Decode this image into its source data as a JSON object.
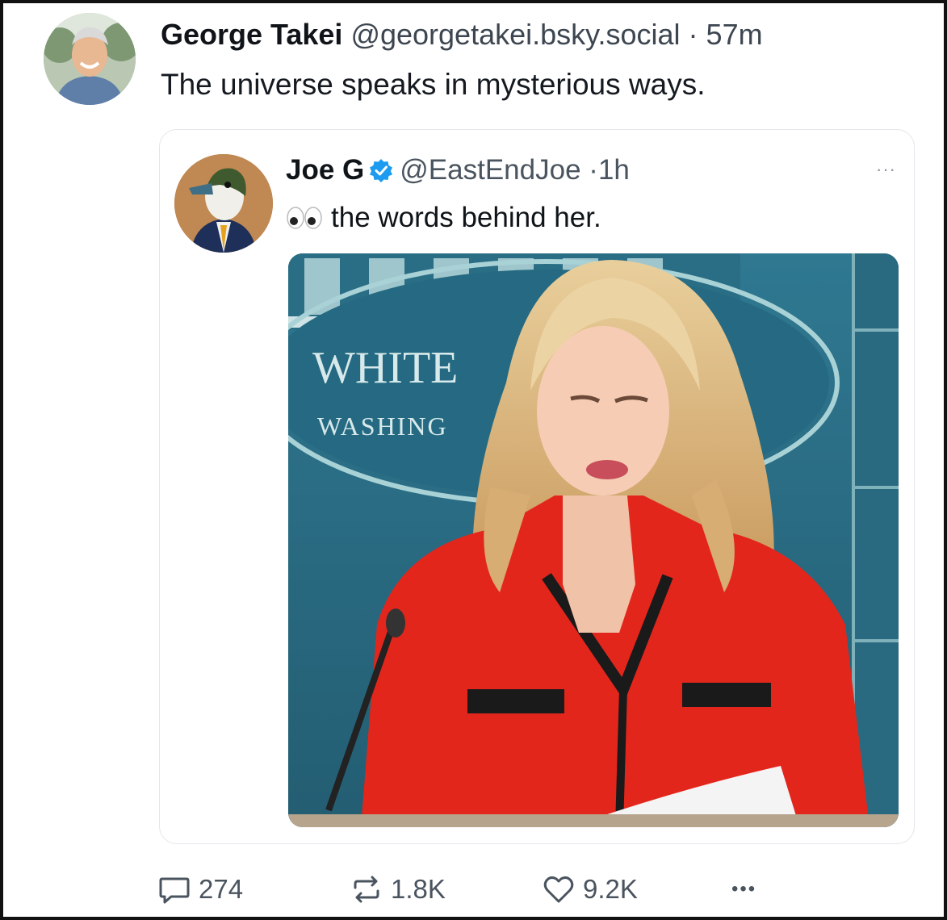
{
  "post": {
    "author_name": "George Takei",
    "author_handle": "@georgetakei.bsky.social",
    "separator": "·",
    "time": "57m",
    "text": "The universe speaks in mysterious ways."
  },
  "quoted_post": {
    "author_name": "Joe G",
    "author_handle": "@EastEndJoe",
    "separator": "·",
    "time": "1h",
    "text": "the words behind her.",
    "more_label": "···",
    "media": {
      "sign_line1": "WHITE",
      "sign_line2": "WASHING"
    }
  },
  "actions": {
    "reply_count": "274",
    "repost_count": "1.8K",
    "like_count": "9.2K",
    "more_label": "•••"
  },
  "colors": {
    "verified": "#1d9bf0",
    "jacket": "#e3261c",
    "backdrop": "#2c6f88"
  },
  "icons": [
    "reply-icon",
    "repost-icon",
    "like-icon",
    "more-icon",
    "verified-icon",
    "eyes-emoji"
  ]
}
